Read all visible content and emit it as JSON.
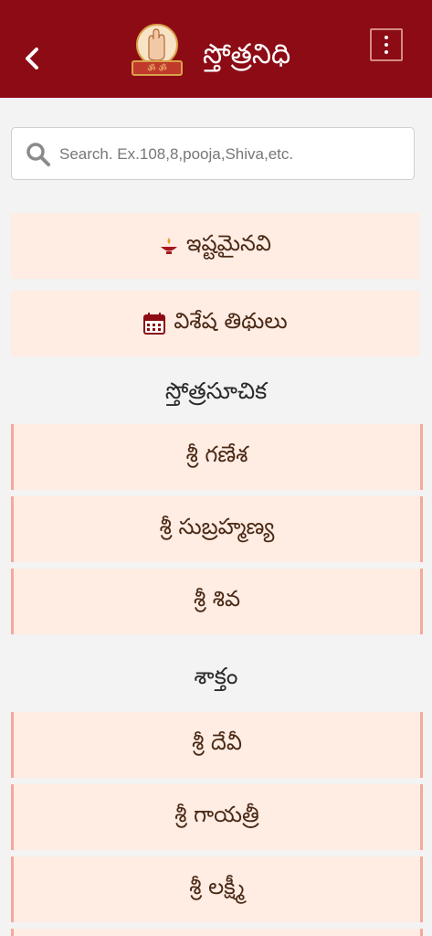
{
  "header": {
    "title": "స్తోత్రనిధి",
    "back_icon": "back-arrow-icon",
    "menu_icon": "kebab-menu-icon",
    "logo_text": "ॐ ॐ"
  },
  "search": {
    "placeholder": "Search. Ex.108,8,pooja,Shiva,etc.",
    "value": ""
  },
  "quick_links": [
    {
      "label": "ఇష్టమైనవి",
      "icon": "lamp-icon"
    },
    {
      "label": "విశేష తిథులు",
      "icon": "calendar-icon"
    }
  ],
  "sections": [
    {
      "title": "స్తోత్రసూచిక",
      "items": [
        "శ్రీ గణేశ",
        "శ్రీ సుబ్రహ్మణ్య",
        "శ్రీ శివ"
      ]
    },
    {
      "title": "శాక్తం",
      "items": [
        "శ్రీ దేవీ",
        "శ్రీ గాయత్రీ",
        "శ్రీ లక్ష్మీ"
      ]
    }
  ],
  "colors": {
    "header_bg": "#8c0b14",
    "card_bg": "#ffece3",
    "card_border": "#f4a99a",
    "card_text": "#4a2a16",
    "page_bg": "#f3f3f3"
  }
}
